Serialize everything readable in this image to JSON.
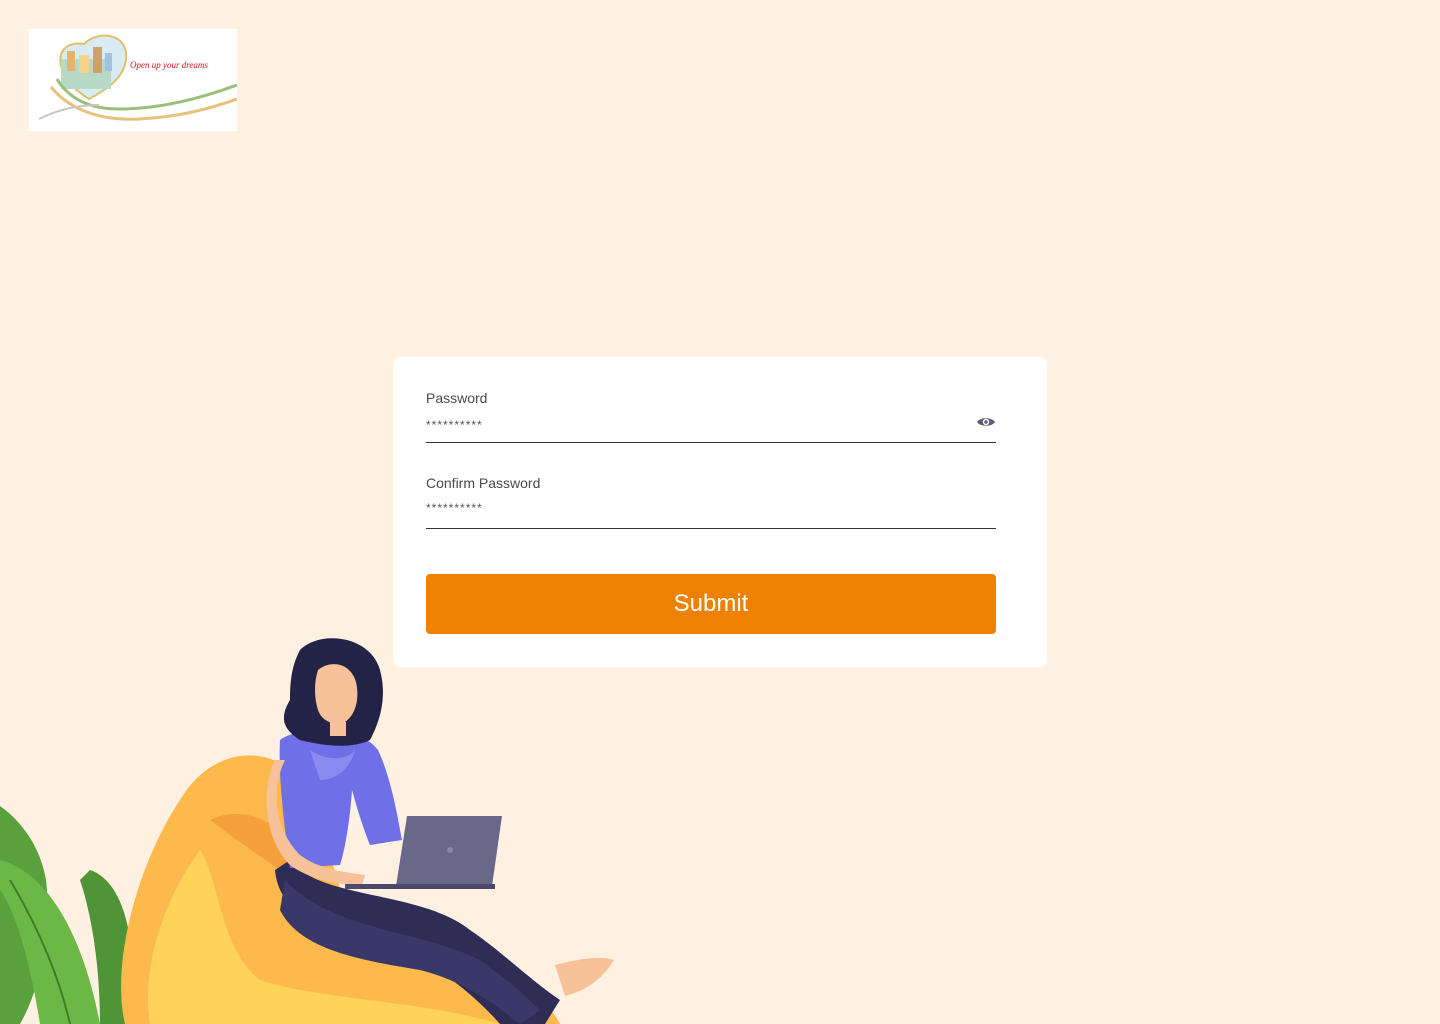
{
  "logo": {
    "tagline": "Open up your dreams"
  },
  "form": {
    "password": {
      "label": "Password",
      "value": "**********"
    },
    "confirm_password": {
      "label": "Confirm Password",
      "value": "**********"
    },
    "submit_label": "Submit"
  },
  "icons": {
    "toggle_visibility": "eye-icon"
  },
  "colors": {
    "background": "#fff1e1",
    "accent": "#ee8200",
    "card": "#ffffff"
  }
}
